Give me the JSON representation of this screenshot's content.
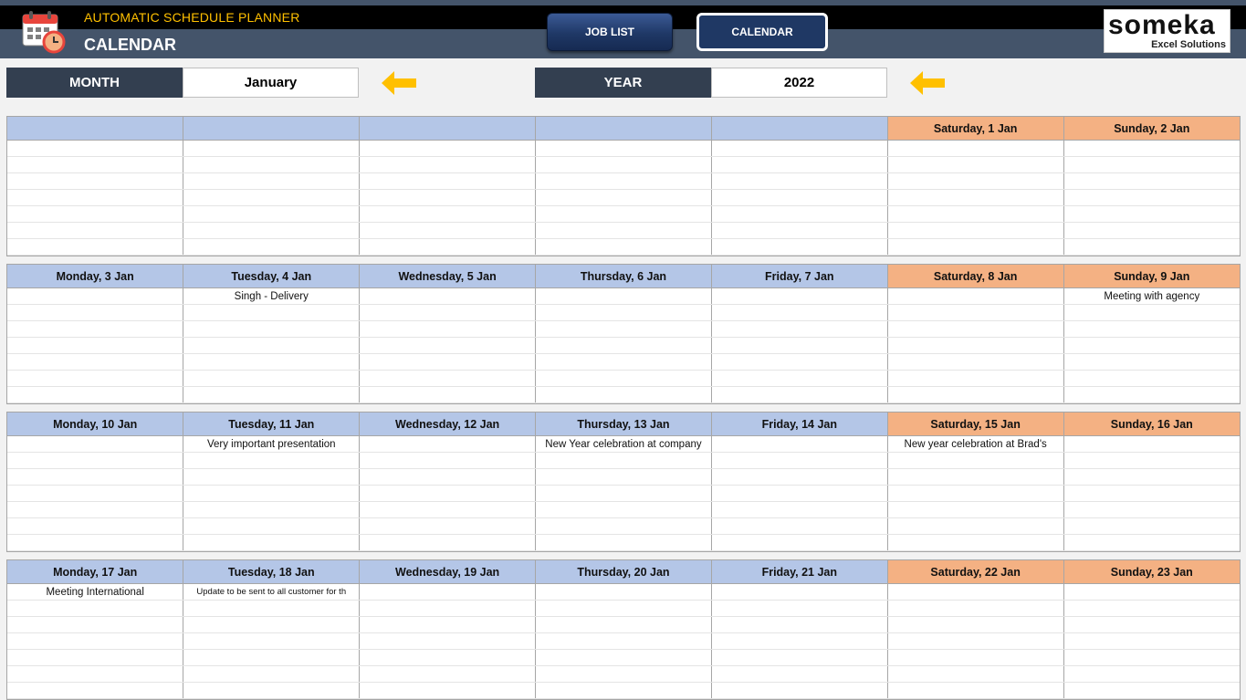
{
  "header": {
    "app_title": "AUTOMATIC SCHEDULE PLANNER",
    "page_title": "CALENDAR",
    "nav": {
      "job_list": "JOB LIST",
      "calendar": "CALENDAR"
    },
    "brand": {
      "name": "someka",
      "tagline": "Excel Solutions"
    }
  },
  "selectors": {
    "month_label": "MONTH",
    "month_value": "January",
    "year_label": "YEAR",
    "year_value": "2022"
  },
  "colors": {
    "weekday_header": "#b4c6e7",
    "weekend_header": "#f4b183",
    "accent": "#ffc000",
    "dark": "#333f50"
  },
  "weeks": [
    {
      "days": [
        "",
        "",
        "",
        "",
        "",
        "Saturday, 1 Jan",
        "Sunday, 2 Jan"
      ],
      "rows": [
        [
          "",
          "",
          "",
          "",
          "",
          "",
          ""
        ]
      ]
    },
    {
      "days": [
        "Monday, 3 Jan",
        "Tuesday, 4 Jan",
        "Wednesday, 5 Jan",
        "Thursday, 6 Jan",
        "Friday, 7 Jan",
        "Saturday, 8 Jan",
        "Sunday, 9 Jan"
      ],
      "rows": [
        [
          "",
          "Singh - Delivery",
          "",
          "",
          "",
          "",
          "Meeting with agency"
        ]
      ]
    },
    {
      "days": [
        "Monday, 10 Jan",
        "Tuesday, 11 Jan",
        "Wednesday, 12 Jan",
        "Thursday, 13 Jan",
        "Friday, 14 Jan",
        "Saturday, 15 Jan",
        "Sunday, 16 Jan"
      ],
      "rows": [
        [
          "",
          "Very important presentation",
          "",
          "New Year celebration at company",
          "",
          "New year celebration at Brad's",
          ""
        ]
      ]
    },
    {
      "days": [
        "Monday, 17 Jan",
        "Tuesday, 18 Jan",
        "Wednesday, 19 Jan",
        "Thursday, 20 Jan",
        "Friday, 21 Jan",
        "Saturday, 22 Jan",
        "Sunday, 23 Jan"
      ],
      "rows": [
        [
          "Meeting International",
          "Update to be sent to all customer for th",
          "",
          "",
          "",
          "",
          ""
        ]
      ]
    }
  ]
}
